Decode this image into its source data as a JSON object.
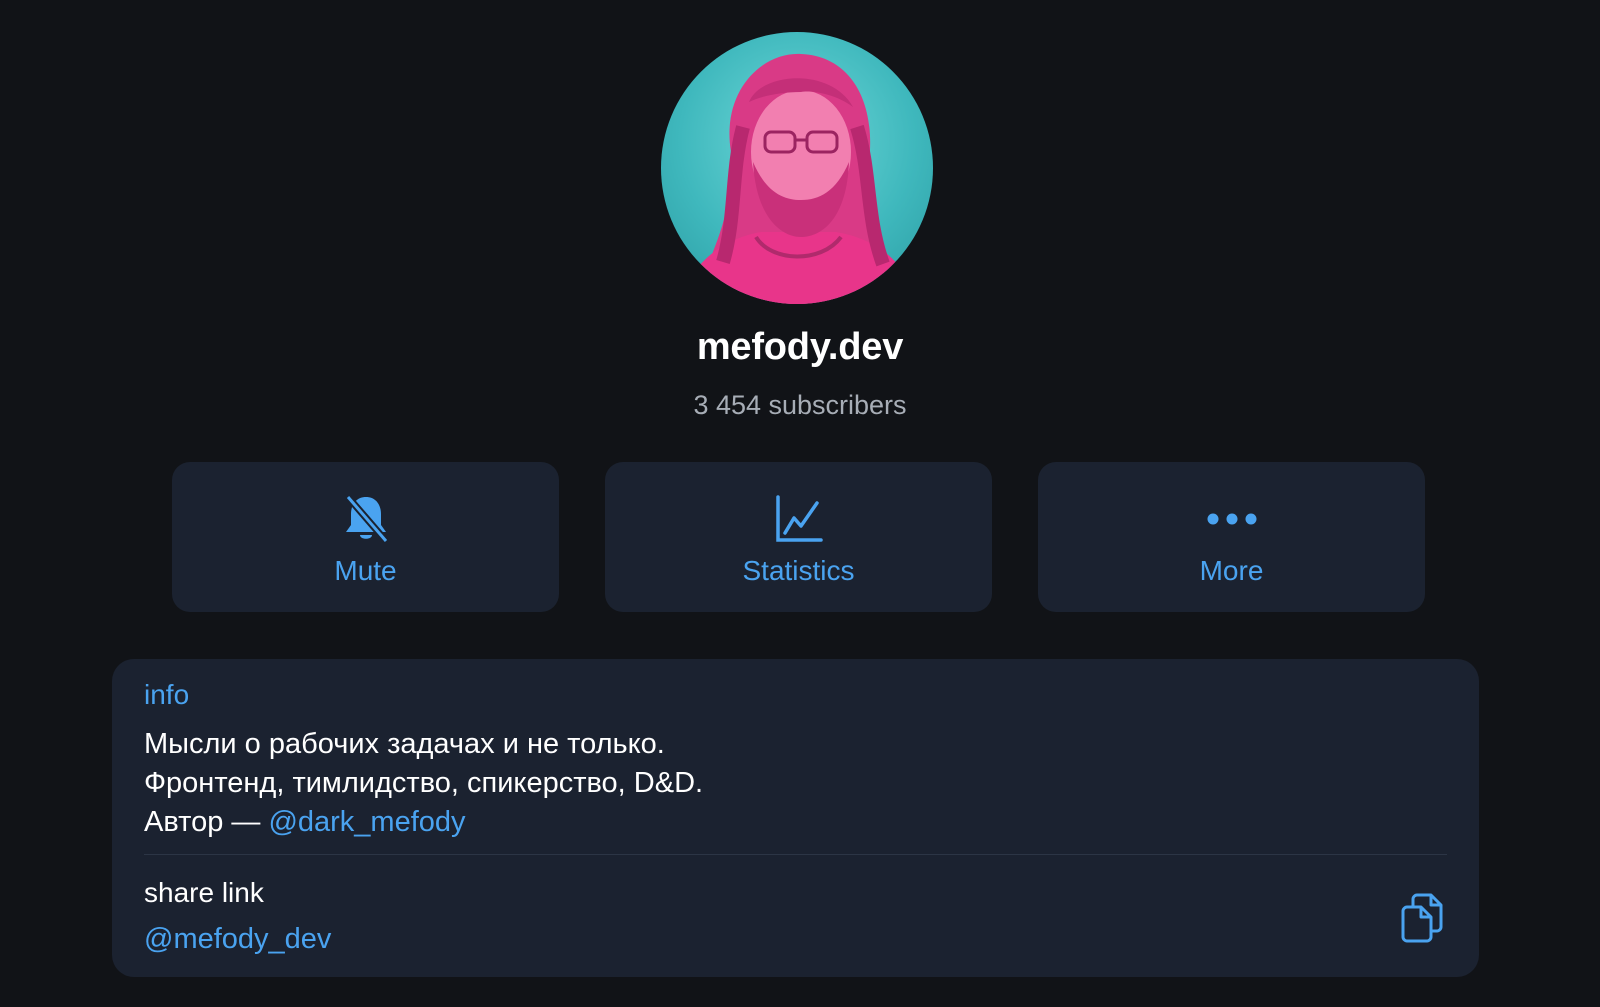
{
  "channel": {
    "name": "mefody.dev",
    "subscribers": "3 454 subscribers"
  },
  "actions": [
    {
      "label": "Mute",
      "icon": "bell-muted-icon"
    },
    {
      "label": "Statistics",
      "icon": "chart-icon"
    },
    {
      "label": "More",
      "icon": "more-dots-icon"
    }
  ],
  "info": {
    "label": "info",
    "lines": [
      "Мысли о рабочих задачах и не только.",
      "Фронтенд, тимлидство, спикерство, D&D."
    ],
    "author_prefix": "Автор — ",
    "author_link": "@dark_mefody"
  },
  "share": {
    "label": "share link",
    "handle": "@mefody_dev",
    "copy_icon": "copy-icon"
  },
  "colors": {
    "background": "#111317",
    "card": "#1b2230",
    "accent": "#4aa3f0",
    "muted_text": "#a7adb6",
    "avatar_tint": "#e8358a",
    "avatar_bg": "#3fb8bd"
  }
}
